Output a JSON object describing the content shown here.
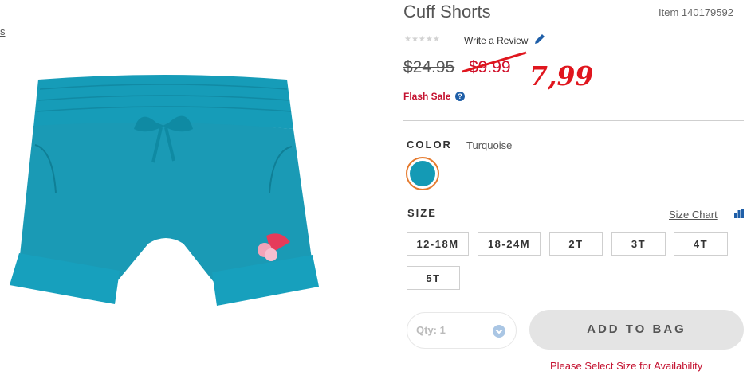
{
  "breadcrumb": {
    "fragment": "s"
  },
  "product": {
    "title": "Cuff Shorts",
    "item_number": "Item 140179592",
    "stars": "★★★★★",
    "write_review": "Write a Review",
    "price_original": "$24.95",
    "price_sale": "$9.99",
    "price_annotation": "7,99",
    "flash_sale": "Flash Sale",
    "help_glyph": "?"
  },
  "color": {
    "label": "COLOR",
    "value": "Turquoise",
    "swatch_hex": "#149ab5"
  },
  "size": {
    "label": "SIZE",
    "chart_link": "Size Chart",
    "options": [
      "12-18M",
      "18-24M",
      "2T",
      "3T",
      "4T",
      "5T"
    ]
  },
  "purchase": {
    "qty_label": "Qty: 1",
    "add_to_bag": "ADD TO BAG",
    "availability_msg": "Please Select Size for Availability"
  },
  "colors": {
    "accent_red": "#d0112b",
    "annotation_red": "#e0161e",
    "swatch_ring": "#e57a2e",
    "shorts": "#1a9ab5"
  },
  "icons": [
    "pencil-icon",
    "question-icon",
    "size-chart-bars-icon",
    "chevron-down-icon"
  ]
}
